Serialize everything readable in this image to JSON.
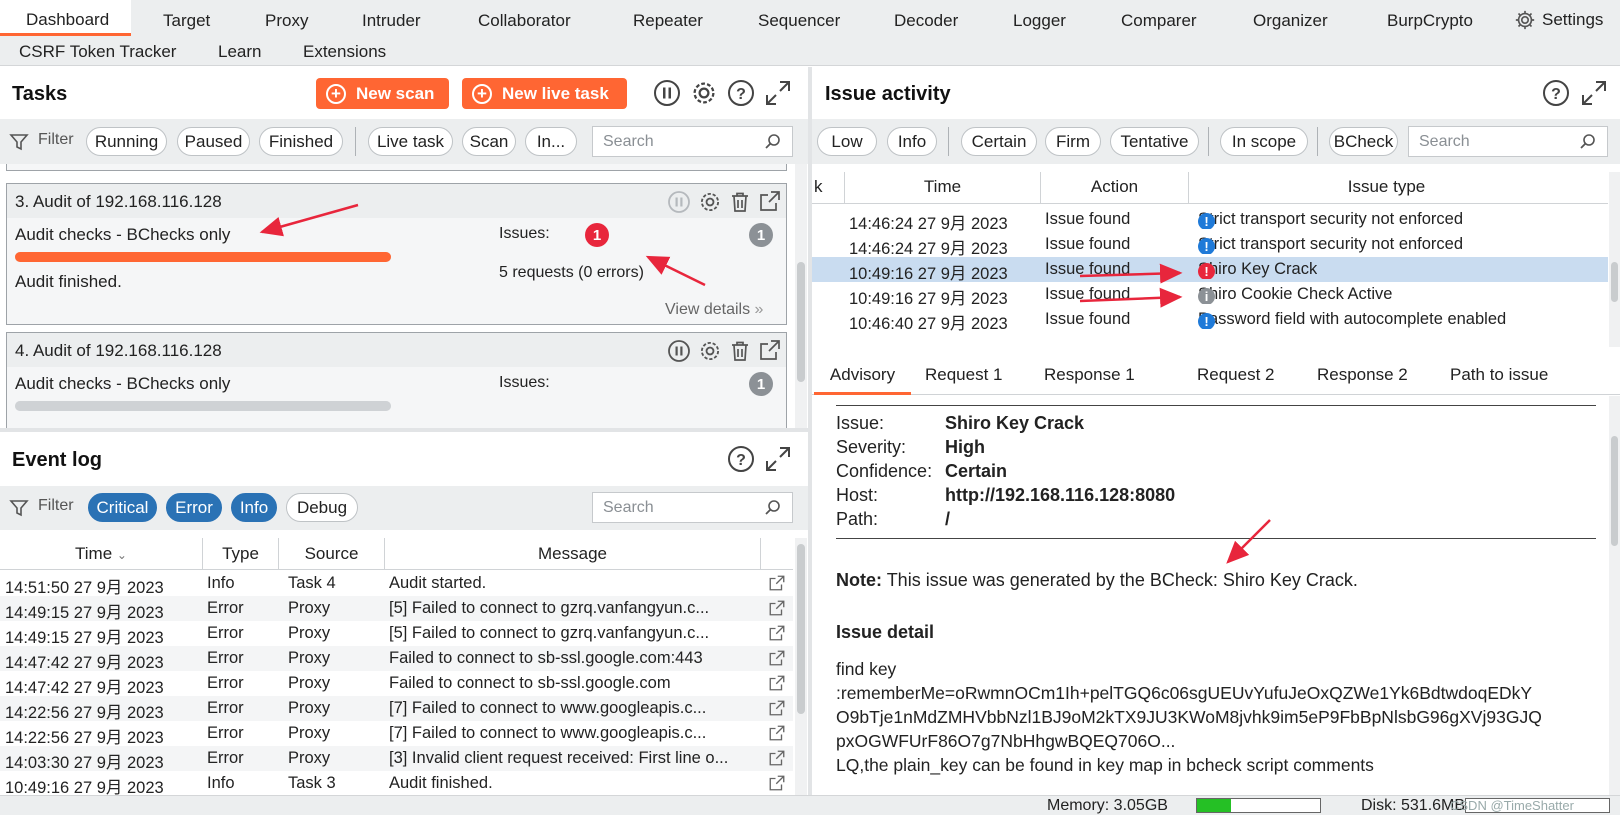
{
  "nav": {
    "row1": [
      "Dashboard",
      "Target",
      "Proxy",
      "Intruder",
      "Collaborator",
      "Repeater",
      "Sequencer",
      "Decoder",
      "Logger",
      "Comparer",
      "Organizer",
      "BurpCrypto"
    ],
    "settings": "Settings",
    "row2": [
      "CSRF Token Tracker",
      "Learn",
      "Extensions"
    ]
  },
  "tasks": {
    "title": "Tasks",
    "new_scan": "New scan",
    "new_live_task": "New live task",
    "filter_label": "Filter",
    "filters": [
      "Running",
      "Paused",
      "Finished"
    ],
    "type_filters": [
      "Live task",
      "Scan",
      "In..."
    ],
    "search_placeholder": "Search",
    "cards": [
      {
        "title": "3. Audit of 192.168.116.128",
        "subtitle": "Audit checks - BChecks only",
        "issues_label": "Issues:",
        "issue_count": "1",
        "info_count": "1",
        "status": "Audit finished.",
        "requests": "5 requests (0 errors)",
        "view_details": "View details",
        "progress": 1.0
      },
      {
        "title": "4. Audit of 192.168.116.128",
        "subtitle": "Audit checks - BChecks only",
        "issues_label": "Issues:",
        "info_count": "1",
        "progress": 1.0
      }
    ]
  },
  "event_log": {
    "title": "Event log",
    "filter_label": "Filter",
    "filters": [
      "Critical",
      "Error",
      "Info",
      "Debug"
    ],
    "search_placeholder": "Search",
    "columns": [
      "Time",
      "Type",
      "Source",
      "Message"
    ],
    "rows": [
      {
        "time": "14:51:50 27 9月 2023",
        "type": "Info",
        "source": "Task 4",
        "message": "Audit started."
      },
      {
        "time": "14:49:15 27 9月 2023",
        "type": "Error",
        "source": "Proxy",
        "message": "[5]  Failed to connect to gzrq.vanfangyun.c..."
      },
      {
        "time": "14:49:15 27 9月 2023",
        "type": "Error",
        "source": "Proxy",
        "message": "[5]  Failed to connect to gzrq.vanfangyun.c..."
      },
      {
        "time": "14:47:42 27 9月 2023",
        "type": "Error",
        "source": "Proxy",
        "message": "Failed to connect to sb-ssl.google.com:443"
      },
      {
        "time": "14:47:42 27 9月 2023",
        "type": "Error",
        "source": "Proxy",
        "message": "Failed to connect to sb-ssl.google.com"
      },
      {
        "time": "14:22:56 27 9月 2023",
        "type": "Error",
        "source": "Proxy",
        "message": "[7]  Failed to connect to www.googleapis.c..."
      },
      {
        "time": "14:22:56 27 9月 2023",
        "type": "Error",
        "source": "Proxy",
        "message": "[7]  Failed to connect to www.googleapis.c..."
      },
      {
        "time": "14:03:30 27 9月 2023",
        "type": "Error",
        "source": "Proxy",
        "message": "[3]  Invalid client request received: First line o..."
      },
      {
        "time": "10:49:16 27 9月 2023",
        "type": "Info",
        "source": "Task 3",
        "message": "Audit finished."
      }
    ]
  },
  "issue_activity": {
    "title": "Issue activity",
    "filters_severity": [
      "Low",
      "Info"
    ],
    "filters_confidence": [
      "Certain",
      "Firm",
      "Tentative"
    ],
    "filters_scope": [
      "In scope"
    ],
    "filters_extra": [
      "BCheck"
    ],
    "search_placeholder": "Search",
    "columns": [
      "k",
      "Time",
      "Action",
      "Issue type"
    ],
    "rows": [
      {
        "time": "14:46:24 27 9月 2023",
        "action": "Issue found",
        "issue": "Strict transport security not enforced",
        "sev": "info",
        "selected": false
      },
      {
        "time": "14:46:24 27 9月 2023",
        "action": "Issue found",
        "issue": "Strict transport security not enforced",
        "sev": "info",
        "selected": false
      },
      {
        "time": "10:49:16 27 9月 2023",
        "action": "Issue found",
        "issue": "Shiro Key Crack",
        "sev": "high",
        "selected": true
      },
      {
        "time": "10:49:16 27 9月 2023",
        "action": "Issue found",
        "issue": "Shiro Cookie Check Active",
        "sev": "grey",
        "selected": false
      },
      {
        "time": "10:46:40 27 9月 2023",
        "action": "Issue found",
        "issue": "Password field with autocomplete enabled",
        "sev": "info",
        "selected": false
      }
    ]
  },
  "advisory": {
    "tabs": [
      "Advisory",
      "Request 1",
      "Response 1",
      "Request 2",
      "Response 2",
      "Path to issue"
    ],
    "fields": [
      {
        "label": "Issue:",
        "value": "Shiro Key Crack"
      },
      {
        "label": "Severity:",
        "value": "High"
      },
      {
        "label": "Confidence:",
        "value": "Certain"
      },
      {
        "label": "Host:",
        "value": "http://192.168.116.128:8080"
      },
      {
        "label": "Path:",
        "value": "/"
      }
    ],
    "note_label": "Note:",
    "note_text": "This issue was generated by the BCheck: Shiro Key Crack.",
    "detail_heading": "Issue detail",
    "detail_lines": [
      "find key",
      ":rememberMe=oRwmnOCm1Ih+pelTGQ6c06sgUEUvYufuJeOxQZWe1Yk6BdtwdoqEDkY",
      "O9bTje1nMdZMHVbbNzl1BJ9oM2kTX9JU3KWoM8jvhk9im5eP9FbBpNlsbG96gXVj93GJQ",
      "pxOGWFUrF86O7g7NbHhgwBQEQ706O...",
      "LQ,the plain_key can be found in key map in bcheck script comments"
    ]
  },
  "status": {
    "memory_label": "Memory: 3.05GB",
    "memory_fraction": 0.28,
    "disk_label": "Disk: 531.6MB",
    "watermark": "CSDN @TimeShatter"
  }
}
